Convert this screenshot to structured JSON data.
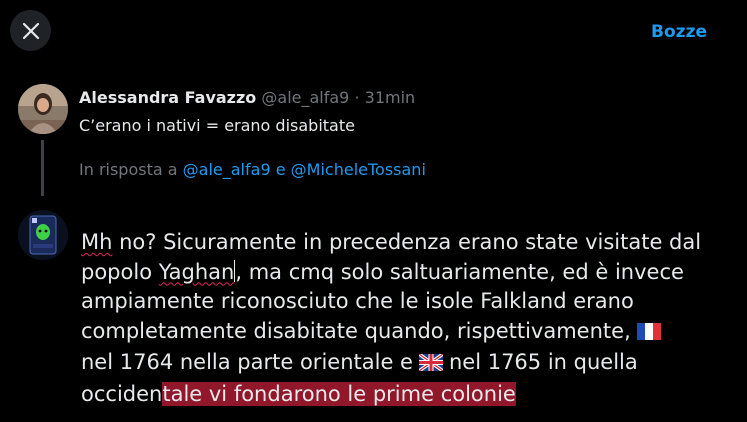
{
  "header": {
    "drafts_label": "Bozze"
  },
  "original_tweet": {
    "author_name": "Alessandra Favazzo",
    "handle": "@ale_alfa9",
    "separator": "·",
    "time": "31min",
    "text": "C’erano i nativi = erano disabitate",
    "reply_prefix": "In risposta a",
    "reply_mention_1": "@ale_alfa9",
    "reply_and": "e",
    "reply_mention_2": "@MicheleTossani"
  },
  "composer": {
    "l1_misspelled": "Mh",
    "l1_rest": " no? Sicuramente in precedenza erano state visitate dal",
    "l2_a": "popolo ",
    "l2_misspelled": "Yaghan",
    "l2_rest": ", ma cmq solo saltuariamente, ed è invece",
    "l3": "ampiamente riconosciuto che le isole Falkland erano",
    "l4": "completamente disabitate quando, rispettivamente,",
    "l5_a": "nel 1764 nella parte orientale e",
    "l5_b": "nel 1765 in quella",
    "l6_plain": "occiden",
    "l6_highlighted": "tale vi fondarono le prime colonie",
    "flag_1": "france-flag",
    "flag_2": "uk-flag"
  },
  "colors": {
    "accent": "#1d9bf0",
    "highlight": "#91172a",
    "muted": "#71767b"
  }
}
